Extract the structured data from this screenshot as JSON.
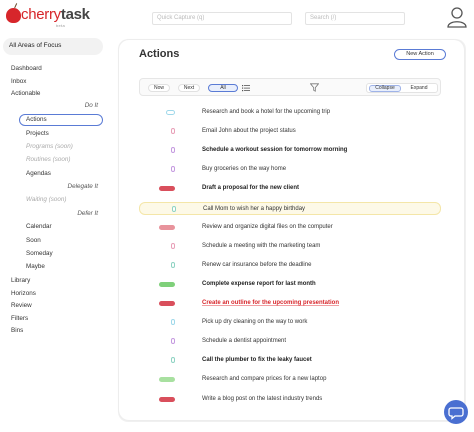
{
  "header": {
    "logo_word_1": "cherry",
    "logo_word_2": "task",
    "logo_sub": "beta",
    "quick_capture_placeholder": "Quick Capture (q)",
    "search_placeholder": "Search (/)"
  },
  "sidebar": {
    "areas_label": "All Areas of Focus",
    "items": {
      "dashboard": "Dashboard",
      "inbox": "Inbox",
      "actionable": "Actionable",
      "do_it": "Do It",
      "actions": "Actions",
      "projects": "Projects",
      "programs": "Programs (soon)",
      "routines": "Routines (soon)",
      "agendas": "Agendas",
      "delegate_it": "Delegate It",
      "waiting": "Waiting (soon)",
      "defer_it": "Defer It",
      "calendar": "Calendar",
      "soon": "Soon",
      "someday": "Someday",
      "maybe": "Maybe",
      "library": "Library",
      "horizons": "Horizons",
      "review": "Review",
      "filters": "Filters",
      "bins": "Bins"
    }
  },
  "main": {
    "title": "Actions",
    "new_action": "New Action",
    "toolbar": {
      "now": "Now",
      "next": "Next",
      "all": "All",
      "collapse": "Collapse",
      "expand": "Expand"
    },
    "tasks": [
      {
        "text": "Research and book a hotel for the upcoming trip",
        "style": "normal",
        "prio": "pill",
        "color": "#9fd8ea"
      },
      {
        "text": "Email John about the project status",
        "style": "normal",
        "prio": "dot",
        "color": "#e8a0b8"
      },
      {
        "text": "Schedule a workout session for tomorrow morning",
        "style": "bold",
        "prio": "dot",
        "color": "#c59ae0"
      },
      {
        "text": "Buy groceries on the way home",
        "style": "normal",
        "prio": "dot",
        "color": "#c59ae0"
      },
      {
        "text": "Draft a proposal for the new client",
        "style": "bold",
        "prio": "bar",
        "color": "#d94f5c"
      },
      {
        "text": "Call Mom to wish her a happy birthday",
        "style": "highlight",
        "prio": "dot",
        "color": "#8fd3c3"
      },
      {
        "text": "Review and organize digital files on the computer",
        "style": "normal",
        "prio": "bar",
        "color": "#e8939c"
      },
      {
        "text": "Schedule a meeting with the marketing team",
        "style": "normal",
        "prio": "dot",
        "color": "#e8a0b8"
      },
      {
        "text": "Renew car insurance before the deadline",
        "style": "normal",
        "prio": "dot",
        "color": "#8fd3c3"
      },
      {
        "text": "Complete expense report for last month",
        "style": "bold",
        "prio": "bar",
        "color": "#7fd07a"
      },
      {
        "text": "Create an outline for the upcoming presentation",
        "style": "red",
        "prio": "bar",
        "color": "#d94f5c"
      },
      {
        "text": "Pick up dry cleaning on the way to work",
        "style": "normal",
        "prio": "dot",
        "color": "#9fd8ea"
      },
      {
        "text": "Schedule a dentist appointment",
        "style": "normal",
        "prio": "dot",
        "color": "#c59ae0"
      },
      {
        "text": "Call the plumber to fix the leaky faucet",
        "style": "bold",
        "prio": "dot",
        "color": "#8fd3c3"
      },
      {
        "text": "Research and compare prices for a new laptop",
        "style": "normal",
        "prio": "bar",
        "color": "#a8e0a0"
      },
      {
        "text": "Write a blog post on the latest industry trends",
        "style": "normal",
        "prio": "bar",
        "color": "#d94f5c"
      }
    ]
  },
  "colors": {
    "brand": "#d7262b",
    "accent": "#5a7bd5",
    "chat": "#4a6fd1"
  }
}
